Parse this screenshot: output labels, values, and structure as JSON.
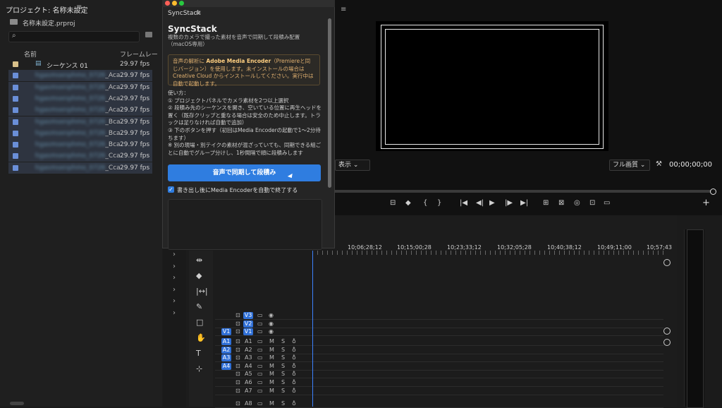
{
  "project": {
    "title": "プロジェクト: 名称未設定",
    "menu_icon": "≡",
    "file": "名称未設定.prproj",
    "col_name": "名前",
    "col_fps": "フレームレー",
    "rows": [
      {
        "name": "シーケンス 01",
        "fps": "29.97 fps",
        "chip": "#d8c08a",
        "blurred": false
      },
      {
        "name": "_Aca",
        "fps": "29.97 fps",
        "chip": "#6a8fd8",
        "blurred": true
      },
      {
        "name": "_Aca",
        "fps": "29.97 fps",
        "chip": "#6a8fd8",
        "blurred": true
      },
      {
        "name": "_Aca",
        "fps": "29.97 fps",
        "chip": "#6a8fd8",
        "blurred": true
      },
      {
        "name": "_Aca",
        "fps": "29.97 fps",
        "chip": "#6a8fd8",
        "blurred": true
      },
      {
        "name": "_Bca",
        "fps": "29.97 fps",
        "chip": "#6a8fd8",
        "blurred": true
      },
      {
        "name": "_Bca",
        "fps": "29.97 fps",
        "chip": "#6a8fd8",
        "blurred": true
      },
      {
        "name": "_Bca",
        "fps": "29.97 fps",
        "chip": "#6a8fd8",
        "blurred": true
      },
      {
        "name": "_Cca",
        "fps": "29.97 fps",
        "chip": "#6a8fd8",
        "blurred": true
      },
      {
        "name": "_Cca",
        "fps": "29.97 fps",
        "chip": "#6a8fd8",
        "blurred": true
      }
    ]
  },
  "panel": {
    "tab": "SyncStack",
    "menu_icon": "≡",
    "heading": "SyncStack",
    "description": "複数のカメラで撮った素材を音声で同期して段積み配置（macOS専用）",
    "notice_pre": "音声の解析に ",
    "notice_bold": "Adobe Media Encoder",
    "notice_post": "（Premiereと同じバージョン）を使用します。未インストールの場合は Creative Cloud からインストールしてください。実行中は自動で起動します。",
    "usage": "使い方：\n① プロジェクトパネルでカメラ素材を2つ以上選択\n② 段積み先のシーケンスを開き、空いている位置に再生ヘッドを置く（既存クリップと重なる場合は安全のため中止します。トラックは足りなければ自動で追加）\n③ 下のボタンを押す（初回はMedia Encoderの起動で1〜2分待ちます）\n※ 別の現場・別テイクの素材が混ざっていても、同期できる組ごとに自動でグループ分けし、1秒間隔で順に段積みします",
    "primary_button": "音声で同期して段積み",
    "checkbox_label": "書き出し後にMedia Encoderを自動で終了する",
    "checkbox_mark": "✓"
  },
  "program": {
    "view_dropdown": "表示",
    "quality_dropdown": "フル画質",
    "timecode": "00;00;00;00",
    "controls": [
      "⊟",
      "◆",
      "{",
      "}",
      "|◀",
      "◀|",
      "▶",
      "|▶",
      "▶|",
      "⊞",
      "⊠",
      "◎",
      "⊡",
      "▭"
    ],
    "add": "+",
    "wrench_icon": "🔧"
  },
  "timeline": {
    "ruler": [
      "10;06;28;12",
      "10;15;00;28",
      "10;23;33;12",
      "10;32;05;28",
      "10;40;38;12",
      "10;49;11;00",
      "10;57;43"
    ],
    "tools": [
      "⇹",
      "◆",
      "|↔|",
      "✎",
      "□",
      "✋",
      "T",
      "⊹"
    ],
    "video_tracks": [
      {
        "label": "V3",
        "src": ""
      },
      {
        "label": "V2",
        "src": ""
      },
      {
        "label": "V1",
        "src": "V1"
      }
    ],
    "audio_tracks": [
      {
        "label": "A1",
        "src": "A1"
      },
      {
        "label": "A2",
        "src": "A2"
      },
      {
        "label": "A3",
        "src": "A3"
      },
      {
        "label": "A4",
        "src": "A4"
      },
      {
        "label": "A5",
        "src": ""
      },
      {
        "label": "A6",
        "src": ""
      },
      {
        "label": "A7",
        "src": ""
      },
      {
        "label": "A8",
        "src": ""
      }
    ],
    "m_label": "M",
    "s_label": "S"
  }
}
